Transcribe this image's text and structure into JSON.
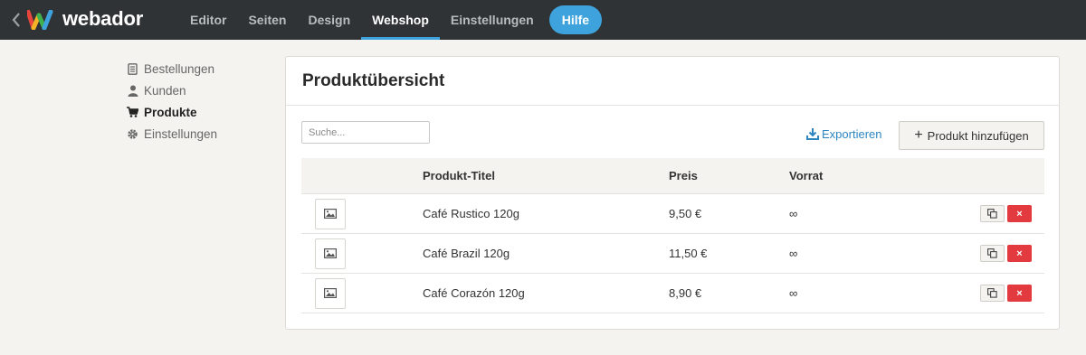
{
  "app": {
    "brand": "webador",
    "colors": {
      "topbar": "#2f3336",
      "accent": "#3ea3dc",
      "danger": "#e23a3e"
    }
  },
  "nav": {
    "items": [
      {
        "label": "Editor",
        "active": false
      },
      {
        "label": "Seiten",
        "active": false
      },
      {
        "label": "Design",
        "active": false
      },
      {
        "label": "Webshop",
        "active": true
      },
      {
        "label": "Einstellungen",
        "active": false
      }
    ],
    "help_label": "Hilfe"
  },
  "sidebar": {
    "items": [
      {
        "label": "Bestellungen",
        "icon": "document-icon"
      },
      {
        "label": "Kunden",
        "icon": "user-icon"
      },
      {
        "label": "Produkte",
        "icon": "cart-icon",
        "active": true
      },
      {
        "label": "Einstellungen",
        "icon": "gear-icon"
      }
    ]
  },
  "main": {
    "title": "Produktübersicht",
    "search_placeholder": "Suche...",
    "export_label": "Exportieren",
    "add_plus": "+",
    "add_label": "Produkt hinzufügen",
    "table": {
      "columns": [
        "",
        "Produkt-Titel",
        "Preis",
        "Vorrat"
      ],
      "rows": [
        {
          "title": "Café Rustico 120g",
          "price": "9,50 €",
          "stock": "∞"
        },
        {
          "title": "Café Brazil 120g",
          "price": "11,50 €",
          "stock": "∞"
        },
        {
          "title": "Café Corazón 120g",
          "price": "8,90 €",
          "stock": "∞"
        }
      ],
      "delete_glyph": "×"
    }
  }
}
